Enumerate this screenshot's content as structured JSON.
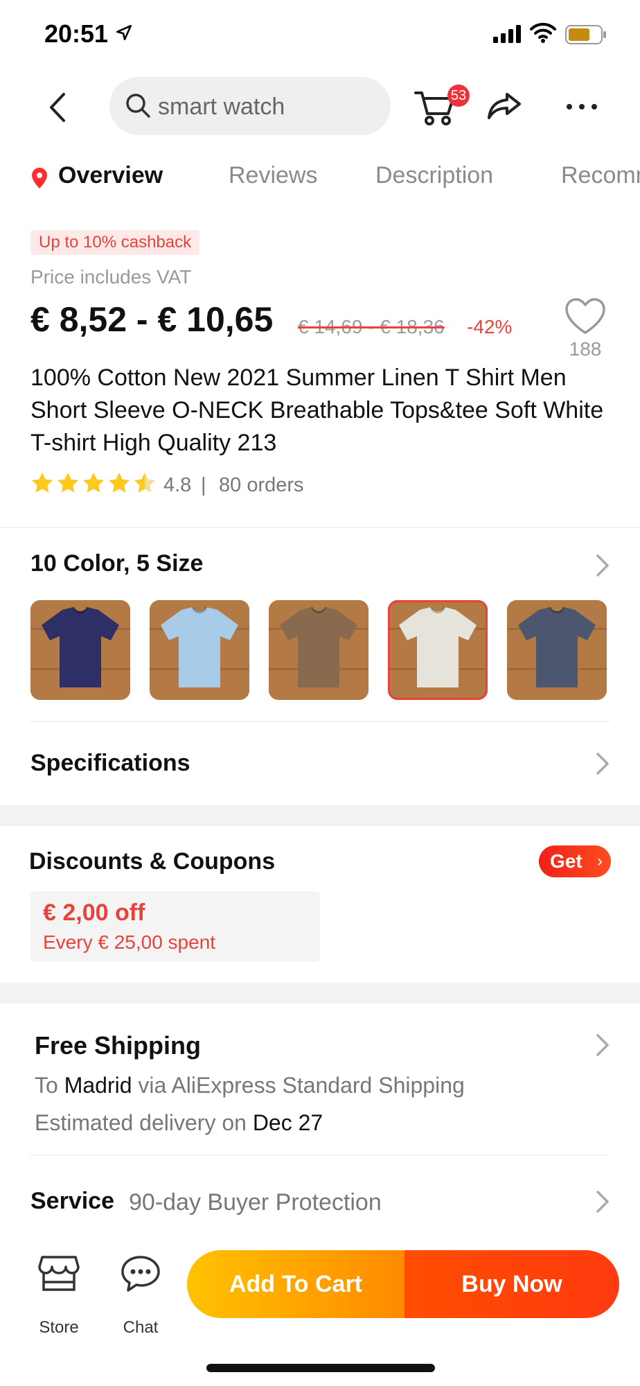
{
  "status_bar": {
    "time": "20:51"
  },
  "nav": {
    "search_text": "smart watch",
    "cart_badge": "53"
  },
  "tabs": [
    "Overview",
    "Reviews",
    "Description",
    "Recomm"
  ],
  "product": {
    "cashback": "Up to 10% cashback",
    "vat": "Price includes VAT",
    "price": "€ 8,52 - € 10,65",
    "original_price": "€ 14,69 - € 18,36",
    "discount": "-42%",
    "wishlist_count": "188",
    "title": "100% Cotton New 2021 Summer Linen T Shirt Men Short Sleeve O-NECK Breathable Tops&tee Soft White T-shirt High Quality 213",
    "rating": "4.8",
    "rating_separator": "|",
    "orders": "80 orders",
    "rating_stars": 4.8
  },
  "variants": {
    "title": "10 Color, 5 Size",
    "swatches": [
      {
        "name": "navy",
        "color": "#2d2f66",
        "selected": false
      },
      {
        "name": "light-blue",
        "color": "#a8cbe8",
        "selected": false
      },
      {
        "name": "brown",
        "color": "#8a6a4f",
        "selected": false
      },
      {
        "name": "white",
        "color": "#e6e3da",
        "selected": true
      },
      {
        "name": "gray-blue",
        "color": "#4c566f",
        "selected": false
      }
    ]
  },
  "specifications": {
    "title": "Specifications"
  },
  "coupons": {
    "title": "Discounts & Coupons",
    "get_label": "Get",
    "amount": "€ 2,00 off",
    "condition": "Every € 25,00 spent"
  },
  "shipping": {
    "title": "Free Shipping",
    "to_prefix": "To ",
    "destination": "Madrid",
    "via": " via AliExpress Standard Shipping",
    "delivery_prefix": "Estimated delivery on ",
    "delivery_date": "Dec 27"
  },
  "service": {
    "title": "Service",
    "detail": "90-day Buyer Protection"
  },
  "bottom_bar": {
    "store_label": "Store",
    "chat_label": "Chat",
    "add_to_cart": "Add To Cart",
    "buy_now": "Buy Now"
  },
  "colors": {
    "accent_red": "#e8433b",
    "add_cart_gradient": [
      "#ffc200",
      "#ff8a00"
    ],
    "buy_now_gradient": [
      "#ff4d00",
      "#ff3a10"
    ]
  }
}
